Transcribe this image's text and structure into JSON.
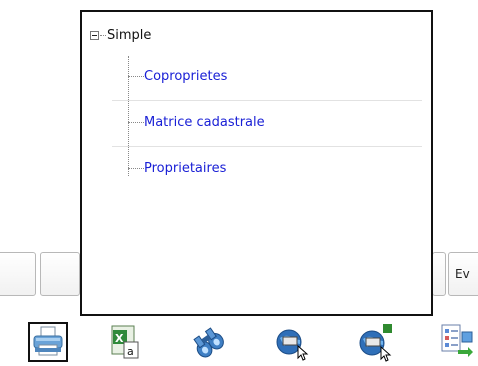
{
  "background": {
    "tab_fragment_label": "Ev"
  },
  "tree": {
    "root": {
      "label": "Simple",
      "expanded": true
    },
    "items": [
      {
        "label": "Coproprietes"
      },
      {
        "label": "Matrice cadastrale"
      },
      {
        "label": "Proprietaires"
      }
    ]
  },
  "toolbar": {
    "icons": [
      "printer-icon",
      "excel-export-icon",
      "binoculars-icon",
      "map-select-icon",
      "map-select-green-icon",
      "checklist-icon"
    ]
  },
  "colors": {
    "link": "#1a20d6",
    "popup_border": "#111111"
  }
}
